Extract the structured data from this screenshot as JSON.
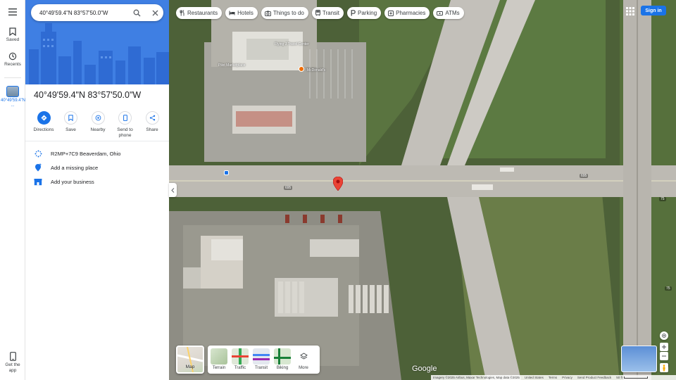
{
  "search": {
    "value": "40°49'59.4\"N 83°57'50.0\"W"
  },
  "rail": {
    "saved": "Saved",
    "recents": "Recents",
    "current_place": "40°49'59.4\"N ...",
    "get_app": "Get the app"
  },
  "place": {
    "title": "40°49'59.4\"N 83°57'50.0\"W",
    "actions": [
      {
        "label": "Directions",
        "icon": "directions-icon"
      },
      {
        "label": "Save",
        "icon": "bookmark-icon"
      },
      {
        "label": "Nearby",
        "icon": "nearby-icon"
      },
      {
        "label": "Send to phone",
        "icon": "phone-icon"
      },
      {
        "label": "Share",
        "icon": "share-icon"
      }
    ],
    "plus_code": "R2MP+7C9 Beaverdam, Ohio",
    "add_missing_place": "Add a missing place",
    "add_business": "Add your business"
  },
  "chips": [
    {
      "label": "Restaurants",
      "icon": "restaurant-icon"
    },
    {
      "label": "Hotels",
      "icon": "hotel-icon"
    },
    {
      "label": "Things to do",
      "icon": "camera-icon"
    },
    {
      "label": "Transit",
      "icon": "transit-icon"
    },
    {
      "label": "Parking",
      "icon": "parking-icon"
    },
    {
      "label": "Pharmacies",
      "icon": "pharmacy-icon"
    },
    {
      "label": "ATMs",
      "icon": "atm-icon"
    }
  ],
  "header": {
    "sign_in": "Sign in"
  },
  "layers": {
    "current": "Map",
    "options": [
      "Terrain",
      "Traffic",
      "Transit",
      "Biking",
      "More"
    ]
  },
  "map_labels": {
    "road_695_left": "695",
    "road_695_right": "695",
    "hwy_75": "75",
    "business_1": "Flying J Travel Center",
    "business_2": "McDonald's",
    "business_3": "Pilot Marketplace"
  },
  "footer": {
    "imagery": "Imagery ©2025 Airbus, Maxar Technologies, Map data ©2025",
    "country": "United States",
    "terms": "Terms",
    "privacy": "Privacy",
    "feedback": "Send Product Feedback",
    "scale": "50 ft"
  },
  "brand": {
    "logo": "Google"
  },
  "colors": {
    "accent": "#1a73e8",
    "pin": "#ea4335"
  }
}
